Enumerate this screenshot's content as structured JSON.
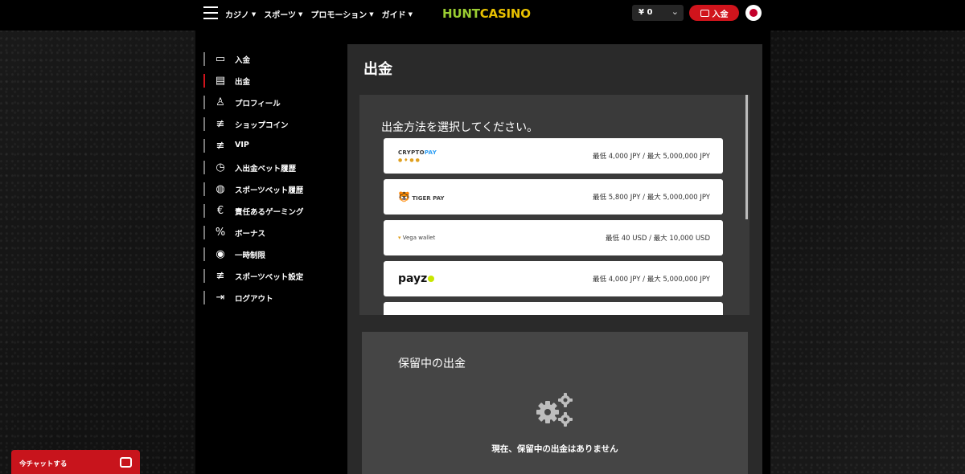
{
  "header": {
    "nav": [
      "カジノ",
      "スポーツ",
      "プロモーション",
      "ガイド"
    ],
    "logo_h": "H",
    "logo_unt": "UNT",
    "logo_casino": "CASINO",
    "currency": "¥ 0",
    "deposit_label": "入金"
  },
  "sidebar": {
    "items": [
      {
        "label": "入金",
        "icon": "cash-icon"
      },
      {
        "label": "出金",
        "icon": "withdraw-icon"
      },
      {
        "label": "プロフィール",
        "icon": "user-icon"
      },
      {
        "label": "ショップコイン",
        "icon": "sliders-icon"
      },
      {
        "label": "VIP",
        "icon": "sliders-icon"
      },
      {
        "label": "入出金ベット履歴",
        "icon": "timer-icon"
      },
      {
        "label": "スポーツベット履歴",
        "icon": "ball-icon"
      },
      {
        "label": "責任あるゲーミング",
        "icon": "euro-circle-icon"
      },
      {
        "label": "ボーナス",
        "icon": "percent-icon"
      },
      {
        "label": "一時制限",
        "icon": "eye-icon"
      },
      {
        "label": "スポーツベット設定",
        "icon": "sliders-icon"
      },
      {
        "label": "ログアウト",
        "icon": "logout-icon"
      }
    ],
    "active_index": 1
  },
  "main": {
    "title": "出金",
    "methods_heading": "出金方法を選択してください。",
    "methods": [
      {
        "logo_text_a": "CRYPTO",
        "logo_text_b": "PAY",
        "range": "最低 4,000 JPY / 最大 5,000,000 JPY"
      },
      {
        "logo_text": "TIGER PAY",
        "range": "最低 5,800 JPY / 最大 5,000,000 JPY"
      },
      {
        "logo_text": "Vega wallet",
        "range": "最低 40 USD / 最大 10,000 USD"
      },
      {
        "logo_text": "payz",
        "range": "最低 4,000 JPY / 最大 5,000,000 JPY"
      }
    ],
    "pending_title": "保留中の出金",
    "pending_message": "現在、保留中の出金はありません"
  },
  "chat": {
    "label": "今チャットする"
  },
  "colors": {
    "accent_red": "#d0141c",
    "logo_green": "#9acd32",
    "logo_yellow": "#e8c000"
  }
}
